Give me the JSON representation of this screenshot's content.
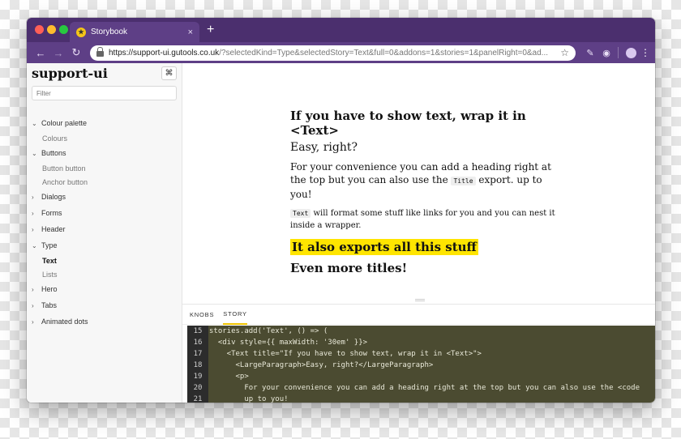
{
  "browser": {
    "tab_title": "Storybook",
    "tab_close": "×",
    "new_tab": "+",
    "url_host": "https://support-ui.gutools.co.uk",
    "url_rest": "/?selectedKind=Type&selectedStory=Text&full=0&addons=1&stories=1&panelRight=0&ad..."
  },
  "sidebar": {
    "brand": "support-ui",
    "shortcut_button": "⌘",
    "filter_placeholder": "Filter",
    "groups": [
      {
        "label": "Colour palette",
        "expanded": true,
        "children": [
          "Colours"
        ]
      },
      {
        "label": "Buttons",
        "expanded": true,
        "children": [
          "Button button",
          "Anchor button"
        ]
      },
      {
        "label": "Dialogs",
        "expanded": false
      },
      {
        "label": "Forms",
        "expanded": false
      },
      {
        "label": "Header",
        "expanded": false
      },
      {
        "label": "Type",
        "expanded": true,
        "children": [
          "Text",
          "Lists"
        ],
        "active_child": "Text"
      },
      {
        "label": "Hero",
        "expanded": false
      },
      {
        "label": "Tabs",
        "expanded": false
      },
      {
        "label": "Animated dots",
        "expanded": false
      }
    ]
  },
  "preview": {
    "heading": "If you have to show text, wrap it in <Text>",
    "large_paragraph": "Easy, right?",
    "para1_before": "For your convenience you can add a heading right at the top but you can also use the ",
    "para1_code": "Title",
    "para1_after": " export. up to you!",
    "para2_code": "Text",
    "para2_after": " will format some stuff like links for you and you can nest it inside a wrapper.",
    "highlight": "It also exports all this stuff",
    "heading2": "Even more titles!"
  },
  "panel": {
    "tabs": [
      "KNOBS",
      "STORY"
    ],
    "active_tab": "STORY",
    "code_lines": [
      {
        "n": "15",
        "text": "stories.add('Text', () => ("
      },
      {
        "n": "16",
        "text": "  <div style={{ maxWidth: '30em' }}>"
      },
      {
        "n": "17",
        "text": "    <Text title=\"If you have to show text, wrap it in <Text>\">"
      },
      {
        "n": "18",
        "text": "      <LargeParagraph>Easy, right?</LargeParagraph>"
      },
      {
        "n": "19",
        "text": "      <p>"
      },
      {
        "n": "20",
        "text": "        For your convenience you can add a heading right at the top but you can also use the <code"
      },
      {
        "n": "21",
        "text": "        up to you!"
      }
    ]
  },
  "colors": {
    "titlebar": "#4b2f6e",
    "toolbar": "#5e3f86",
    "highlight": "#ffe500",
    "code_bg": "#4b4b31",
    "active_tab_underline": "#f0c400"
  }
}
